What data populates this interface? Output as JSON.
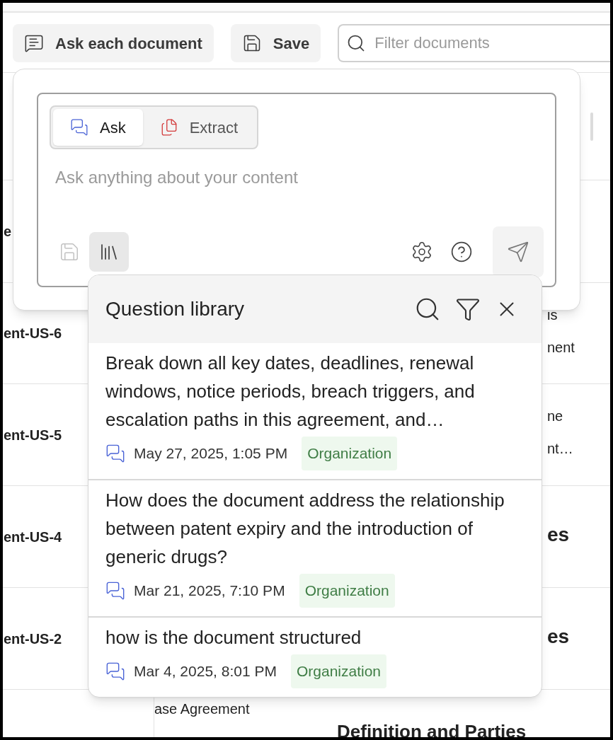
{
  "toolbar": {
    "buttons": [
      {
        "label": "Ask each document",
        "kind": "ask"
      },
      {
        "label": "Save",
        "kind": "save"
      }
    ],
    "filter": {
      "placeholder": "Filter documents"
    }
  },
  "table": {
    "rows": [
      {
        "column_1": "e"
      },
      {
        "column_1": "ent-US-6",
        "column_3": [
          "is",
          "nent"
        ]
      },
      {
        "column_1": "ent-US-5",
        "column_3": [
          "ne",
          "nt…"
        ]
      },
      {
        "column_1": "ent-US-4",
        "column_3_heading": "es"
      },
      {
        "column_1": "ent-US-2",
        "column_3_heading": "es"
      },
      {
        "column_2": "ase Agreement",
        "column_3_heading": "Definition and Parties"
      }
    ]
  },
  "ask_panel": {
    "modes": [
      {
        "label": "Ask",
        "kind": "ask",
        "selected": true
      },
      {
        "label": "Extract",
        "kind": "extract",
        "selected": false
      }
    ],
    "placeholder": "Ask anything about your content",
    "save_disabled": true,
    "library_open": true
  },
  "question_library": {
    "title": "Question library",
    "items": [
      {
        "text": "Break down all key dates, deadlines, renewal windows, notice periods, breach triggers, and escalation paths in this agreement, and…",
        "date": "May 27, 2025, 1:05 PM",
        "tag": "Organization"
      },
      {
        "text": "How does the document address the relationship between patent expiry and the introduction of generic drugs?",
        "date": "Mar 21, 2025, 7:10 PM",
        "tag": "Organization"
      },
      {
        "text": "how is the document structured",
        "date": "Mar 4, 2025, 8:01 PM",
        "tag": "Organization"
      }
    ]
  }
}
